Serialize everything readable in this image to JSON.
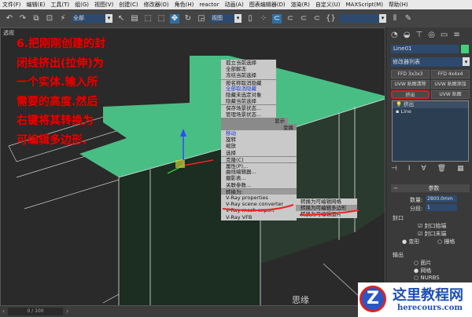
{
  "menubar": [
    "文件(F)",
    "编辑(E)",
    "工具(T)",
    "组(G)",
    "视图(V)",
    "创建(C)",
    "修改器(O)",
    "角色(H)",
    "reactor",
    "动画(A)",
    "图表编辑器(D)",
    "渲染(R)",
    "自定义(U)",
    "MAXScript(M)",
    "帮助(H)"
  ],
  "toolbar": {
    "selection_filter": "全部",
    "coord_system": "视图",
    "named_set": ""
  },
  "viewport": {
    "label": "透视",
    "note_lines": [
      "6.把刚刚创建的封",
      "闭线挤出(拉伸)为",
      "一个实体.输入所",
      "需要的高度.然后",
      "右键将其转换为",
      "可编辑多边形."
    ]
  },
  "context_menu": {
    "display_items": [
      "孤立当前选择",
      "全部解冻",
      "冻结当前选择",
      "按名称取消隐藏",
      "全部取消隐藏",
      "隐藏未选定对象",
      "隐藏当前选择",
      "保存场景状态...",
      "管理场景状态..."
    ],
    "display_header": "显示",
    "transform_header": "变换",
    "transform_items": [
      "移动",
      "旋转",
      "缩放",
      "选择",
      "克隆(C)",
      "属性(P)...",
      "曲线编辑器...",
      "摄影表...",
      "关联参数...",
      "转换为:",
      "V-Ray properties",
      "V-Ray scene converter",
      "V-Ray mesh export",
      "V-Ray VFB"
    ],
    "convert_submenu": [
      "转换为可编辑网格",
      "转换为可编辑多边形",
      "转换为可编辑面片"
    ]
  },
  "right_panel": {
    "object_name": "Line01",
    "object_color": "#3fd17a",
    "modifier_list": "修改器列表",
    "buttons": [
      "FFD 3x3x3",
      "FFD 4x4x4",
      "UVW 贴图清除",
      "UVW 贴图添加",
      "挤出",
      "UVW 贴图"
    ],
    "stack": [
      "挤出",
      "Line"
    ],
    "params_title": "参数",
    "amount_label": "数量:",
    "amount_value": "2800.0mm",
    "segments_label": "分段:",
    "segments_value": "1",
    "capping_title": "封口",
    "cap_start": "封口始端",
    "cap_end": "封口末端",
    "morph": "变形",
    "grid": "栅格",
    "output_title": "输出",
    "patch": "面片",
    "mesh": "网格",
    "nurbs": "NURBS"
  },
  "timeline": {
    "frame": "0 / 100"
  },
  "watermark": {
    "text": "思缘",
    "logo_cn": "这里教程网",
    "logo_en": "herecours.com"
  }
}
